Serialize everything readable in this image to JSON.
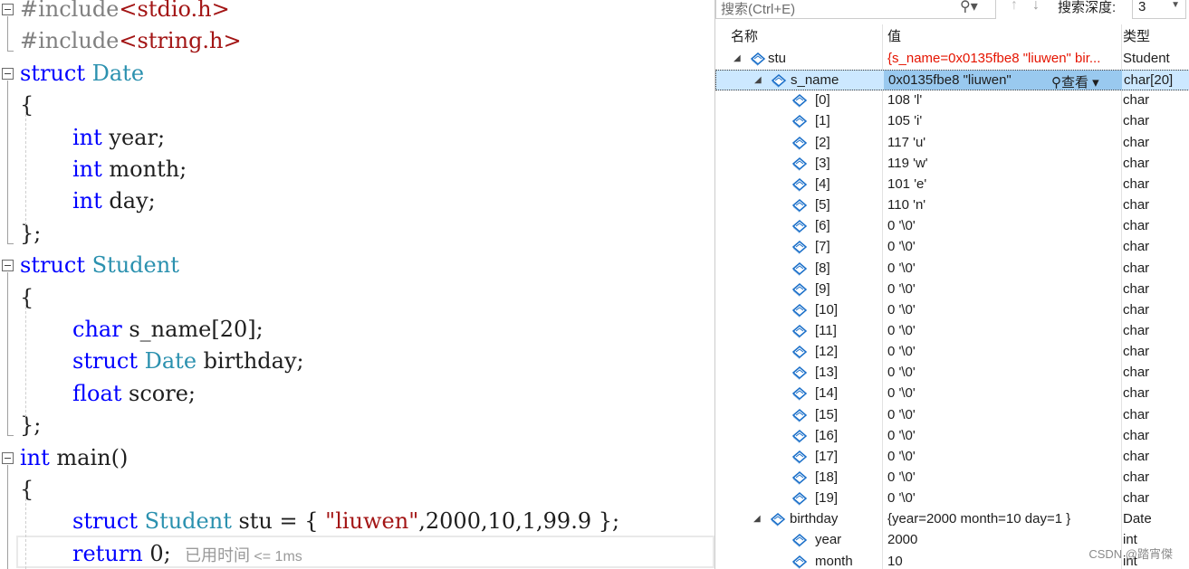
{
  "editor": {
    "lines": [
      {
        "parts": [
          {
            "t": "#include",
            "c": "pp"
          },
          {
            "t": "<stdio.h>",
            "c": "inc"
          }
        ]
      },
      {
        "parts": [
          {
            "t": "#include",
            "c": "pp"
          },
          {
            "t": "<string.h>",
            "c": "inc"
          }
        ]
      },
      {
        "parts": [
          {
            "t": "struct",
            "c": "kw"
          },
          {
            "t": " "
          },
          {
            "t": "Date",
            "c": "ty"
          }
        ]
      },
      {
        "parts": [
          {
            "t": "{"
          }
        ]
      },
      {
        "parts": [
          {
            "t": "int",
            "c": "kw"
          },
          {
            "t": " year;"
          }
        ]
      },
      {
        "parts": [
          {
            "t": "int",
            "c": "kw"
          },
          {
            "t": " month;"
          }
        ]
      },
      {
        "parts": [
          {
            "t": "int",
            "c": "kw"
          },
          {
            "t": " day;"
          }
        ]
      },
      {
        "parts": [
          {
            "t": "};"
          }
        ]
      },
      {
        "parts": [
          {
            "t": "struct",
            "c": "kw"
          },
          {
            "t": " "
          },
          {
            "t": "Student",
            "c": "ty"
          }
        ]
      },
      {
        "parts": [
          {
            "t": "{"
          }
        ]
      },
      {
        "parts": [
          {
            "t": "char",
            "c": "kw"
          },
          {
            "t": " s_name[20];"
          }
        ]
      },
      {
        "parts": [
          {
            "t": "struct",
            "c": "kw"
          },
          {
            "t": " "
          },
          {
            "t": "Date",
            "c": "ty"
          },
          {
            "t": " birthday;"
          }
        ]
      },
      {
        "parts": [
          {
            "t": "float",
            "c": "kw"
          },
          {
            "t": " score;"
          }
        ]
      },
      {
        "parts": [
          {
            "t": "};"
          }
        ]
      },
      {
        "parts": [
          {
            "t": "int",
            "c": "kw"
          },
          {
            "t": " main()"
          }
        ]
      },
      {
        "parts": [
          {
            "t": "{"
          }
        ]
      },
      {
        "parts": [
          {
            "t": "struct",
            "c": "kw"
          },
          {
            "t": " "
          },
          {
            "t": "Student",
            "c": "ty"
          },
          {
            "t": " stu = { "
          },
          {
            "t": "\"liuwen\"",
            "c": "str"
          },
          {
            "t": ",2000,10,1,99.9 };"
          }
        ]
      },
      {
        "parts": [
          {
            "t": "return",
            "c": "kw"
          },
          {
            "t": " 0;  "
          },
          {
            "t": "已用时间",
            "c": "tm"
          },
          {
            "t": " <= 1ms",
            "c": "tm-small"
          }
        ]
      }
    ]
  },
  "watch": {
    "search_placeholder": "搜索(Ctrl+E)",
    "search_icon": "search-icon",
    "depth_label": "搜索深度:",
    "depth_value": "3",
    "headers": {
      "name": "名称",
      "value": "值",
      "type": "类型"
    },
    "view_label": "查看",
    "rows": [
      {
        "name": "stu",
        "value": "{s_name=0x0135fbe8 \"liuwen\" bir...",
        "type": "Student",
        "level": 0,
        "expanded": true,
        "red": true
      },
      {
        "name": "s_name",
        "value": "0x0135fbe8 \"liuwen\"",
        "type": "char[20]",
        "level": 1,
        "expanded": true,
        "selected": true
      },
      {
        "name": "[0]",
        "value": "108 'l'",
        "type": "char",
        "level": 2
      },
      {
        "name": "[1]",
        "value": "105 'i'",
        "type": "char",
        "level": 2
      },
      {
        "name": "[2]",
        "value": "117 'u'",
        "type": "char",
        "level": 2
      },
      {
        "name": "[3]",
        "value": "119 'w'",
        "type": "char",
        "level": 2
      },
      {
        "name": "[4]",
        "value": "101 'e'",
        "type": "char",
        "level": 2
      },
      {
        "name": "[5]",
        "value": "110 'n'",
        "type": "char",
        "level": 2
      },
      {
        "name": "[6]",
        "value": "0 '\\0'",
        "type": "char",
        "level": 2
      },
      {
        "name": "[7]",
        "value": "0 '\\0'",
        "type": "char",
        "level": 2
      },
      {
        "name": "[8]",
        "value": "0 '\\0'",
        "type": "char",
        "level": 2
      },
      {
        "name": "[9]",
        "value": "0 '\\0'",
        "type": "char",
        "level": 2
      },
      {
        "name": "[10]",
        "value": "0 '\\0'",
        "type": "char",
        "level": 2
      },
      {
        "name": "[11]",
        "value": "0 '\\0'",
        "type": "char",
        "level": 2
      },
      {
        "name": "[12]",
        "value": "0 '\\0'",
        "type": "char",
        "level": 2
      },
      {
        "name": "[13]",
        "value": "0 '\\0'",
        "type": "char",
        "level": 2
      },
      {
        "name": "[14]",
        "value": "0 '\\0'",
        "type": "char",
        "level": 2
      },
      {
        "name": "[15]",
        "value": "0 '\\0'",
        "type": "char",
        "level": 2
      },
      {
        "name": "[16]",
        "value": "0 '\\0'",
        "type": "char",
        "level": 2
      },
      {
        "name": "[17]",
        "value": "0 '\\0'",
        "type": "char",
        "level": 2
      },
      {
        "name": "[18]",
        "value": "0 '\\0'",
        "type": "char",
        "level": 2
      },
      {
        "name": "[19]",
        "value": "0 '\\0'",
        "type": "char",
        "level": 2
      },
      {
        "name": "birthday",
        "value": "{year=2000 month=10 day=1 }",
        "type": "Date",
        "level": 1,
        "expanded": true
      },
      {
        "name": "year",
        "value": "2000",
        "type": "int",
        "level": 2
      },
      {
        "name": "month",
        "value": "10",
        "type": "int",
        "level": 2
      }
    ]
  },
  "watermark": "CSDN @踏宵傑",
  "colors": {
    "keyword": "#0000ff",
    "type": "#2b91af",
    "string": "#a31515",
    "selection": "#cce8ff",
    "error_red": "#e51400"
  }
}
